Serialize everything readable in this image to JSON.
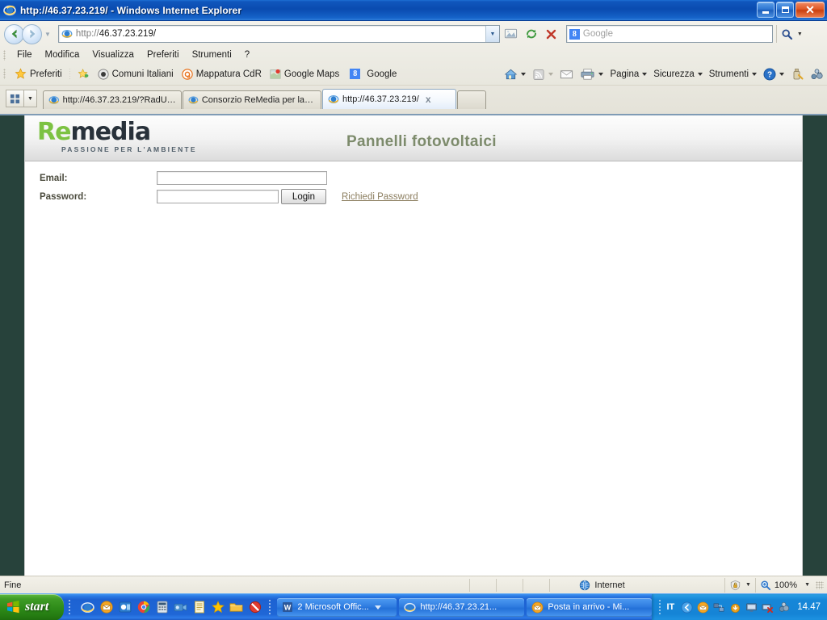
{
  "window": {
    "title": "http://46.37.23.219/ - Windows Internet Explorer",
    "icon": "ie-icon",
    "minimize_label": "Riduci a icona",
    "maximize_label": "Ripristina",
    "close_label": "Chiudi"
  },
  "toolbar": {
    "back_label": "Indietro",
    "forward_label": "Avanti",
    "recent_pages_label": "Pagine recenti",
    "address_value": "http://46.37.23.219/",
    "address_scheme": "http://",
    "address_host": "46.37.23.219/",
    "compat_label": "Visualizzazione compatibilita",
    "refresh_label": "Aggiorna",
    "stop_label": "Interrompi",
    "search_placeholder": "Google",
    "search_engine": "Google",
    "search_go_label": "Cerca"
  },
  "menubar": {
    "items": [
      {
        "label": "File"
      },
      {
        "label": "Modifica"
      },
      {
        "label": "Visualizza"
      },
      {
        "label": "Preferiti"
      },
      {
        "label": "Strumenti"
      },
      {
        "label": "?"
      }
    ]
  },
  "favorites_bar": {
    "favorites_label": "Preferiti",
    "add_label": "Aggiungi a Preferiti",
    "overflow_label": "»",
    "items": [
      {
        "label": "Comuni Italiani",
        "icon": "circle-icon"
      },
      {
        "label": "Mappatura CdR",
        "icon": "at-icon"
      },
      {
        "label": "Google Maps",
        "icon": "maps-icon"
      },
      {
        "label": "Google",
        "icon": "google-icon"
      }
    ]
  },
  "command_bar": {
    "home_label": "Pagina iniziale",
    "feeds_label": "Feed",
    "mail_label": "Leggi posta",
    "print_label": "Stampa",
    "items": [
      {
        "label": "Pagina"
      },
      {
        "label": "Sicurezza"
      },
      {
        "label": "Strumenti"
      }
    ],
    "help_label": "?",
    "extra1_label": "Strumento",
    "extra2_label": "Componente"
  },
  "tabs": {
    "quick_tabs_label": "Schede rapide",
    "tab_list_label": "Elenco schede",
    "items": [
      {
        "label": "http://46.37.23.219/?RadUri...",
        "active": false
      },
      {
        "label": "Consorzio ReMedia per la Ge...",
        "active": false
      },
      {
        "label": "http://46.37.23.219/",
        "active": true,
        "close_label": "x"
      }
    ],
    "new_tab_label": ""
  },
  "page": {
    "logo": {
      "part1": "Re",
      "part2": "media",
      "tagline": "PASSIONE PER L'AMBIENTE",
      "color_green": "#7cc242",
      "color_dark": "#28313a"
    },
    "title": "Pannelli fotovoltaici",
    "title_color": "#7d8b6c",
    "form": {
      "email_label": "Email:",
      "email_value": "",
      "password_label": "Password:",
      "password_value": "",
      "login_button": "Login",
      "request_password_link": "Richiedi Password"
    }
  },
  "statusbar": {
    "status_text": "Fine",
    "zone_label": "Internet",
    "zone_icon": "globe-icon",
    "protected_mode_icon": "lock-icon",
    "zoom_level": "100%",
    "zoom_icon": "magnifier-icon"
  },
  "taskbar": {
    "start_label": "start",
    "quick_launch": [
      {
        "icon": "ie-icon"
      },
      {
        "icon": "mail-icon"
      },
      {
        "icon": "outlook-icon"
      },
      {
        "icon": "chrome-icon"
      },
      {
        "icon": "calculator-icon"
      },
      {
        "icon": "camera-icon"
      },
      {
        "icon": "notepad-icon"
      },
      {
        "icon": "star-icon"
      },
      {
        "icon": "folder-icon"
      },
      {
        "icon": "block-icon"
      }
    ],
    "buttons": [
      {
        "label": "2 Microsoft Offic...",
        "icon": "word-icon",
        "group": true
      },
      {
        "label": "http://46.37.23.21...",
        "icon": "ie-icon",
        "active": true
      },
      {
        "label": "Posta in arrivo - Mi...",
        "icon": "mail-icon"
      }
    ],
    "tray": {
      "language": "IT",
      "icons": [
        "show-hidden-icon",
        "mail-icon",
        "network-icon",
        "update-icon",
        "monitor-icon",
        "network-error-icon",
        "shield-icon"
      ],
      "clock": "14.47"
    }
  }
}
